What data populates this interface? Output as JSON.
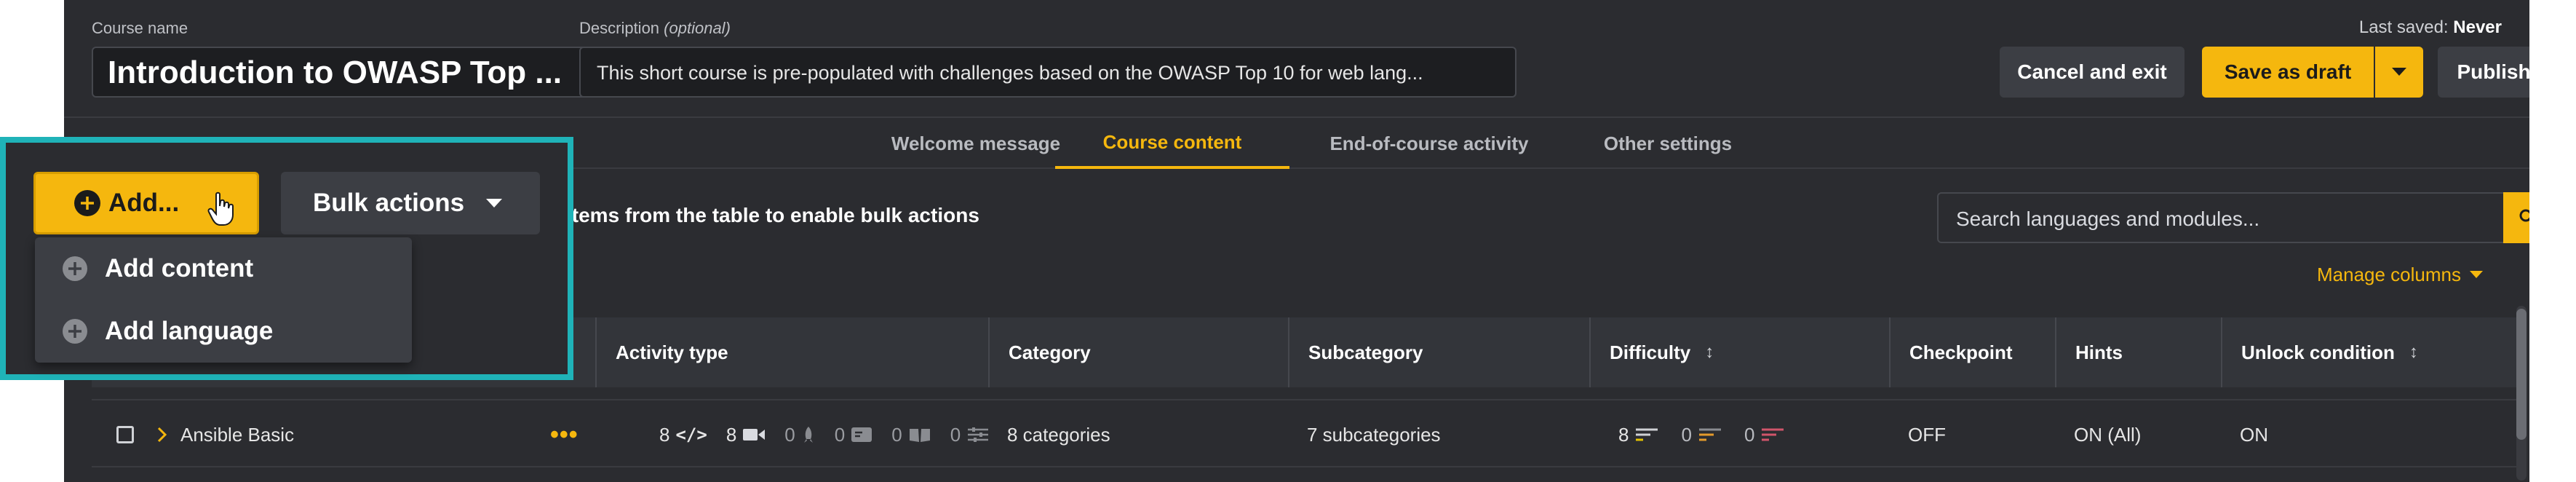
{
  "header": {
    "course_name_label": "Course name",
    "course_name_value": "Introduction to OWASP Top ...",
    "description_label": "Description",
    "description_optional": "(optional)",
    "description_value": "This short course is pre-populated with challenges based on the OWASP Top 10 for web lang...",
    "last_saved_label": "Last saved:",
    "last_saved_value": "Never",
    "cancel_label": "Cancel and exit",
    "save_draft_label": "Save as draft",
    "publish_label": "Publish"
  },
  "tabs": [
    {
      "label": "Welcome message",
      "active": false
    },
    {
      "label": "Course content",
      "active": true
    },
    {
      "label": "End-of-course activity",
      "active": false
    },
    {
      "label": "Other settings",
      "active": false
    }
  ],
  "toolbar": {
    "add_label": "Add...",
    "bulk_label": "Bulk actions",
    "bulk_hint": "items from the table to enable bulk actions",
    "search_placeholder": "Search languages and modules...",
    "manage_columns": "Manage columns"
  },
  "add_menu": {
    "items": [
      "Add content",
      "Add language"
    ]
  },
  "table": {
    "columns": [
      "Activity type",
      "Category",
      "Subcategory",
      "Difficulty",
      "Checkpoint",
      "Hints",
      "Unlock condition"
    ],
    "rows": [
      {
        "name": "Ansible Basic",
        "activity": {
          "code": "8",
          "video": "8",
          "mission": "0",
          "walkthrough": "0",
          "guided": "0",
          "settings": "0"
        },
        "category": "8 categories",
        "subcategory": "7 subcategories",
        "difficulty": {
          "easy": "8",
          "medium": "0",
          "hard": "0"
        },
        "checkpoint": "OFF",
        "hints": "ON (All)",
        "unlock": "ON"
      }
    ]
  },
  "colors": {
    "accent": "#f5b70e",
    "highlight": "#1fb3b8",
    "background": "#2b2c30"
  }
}
